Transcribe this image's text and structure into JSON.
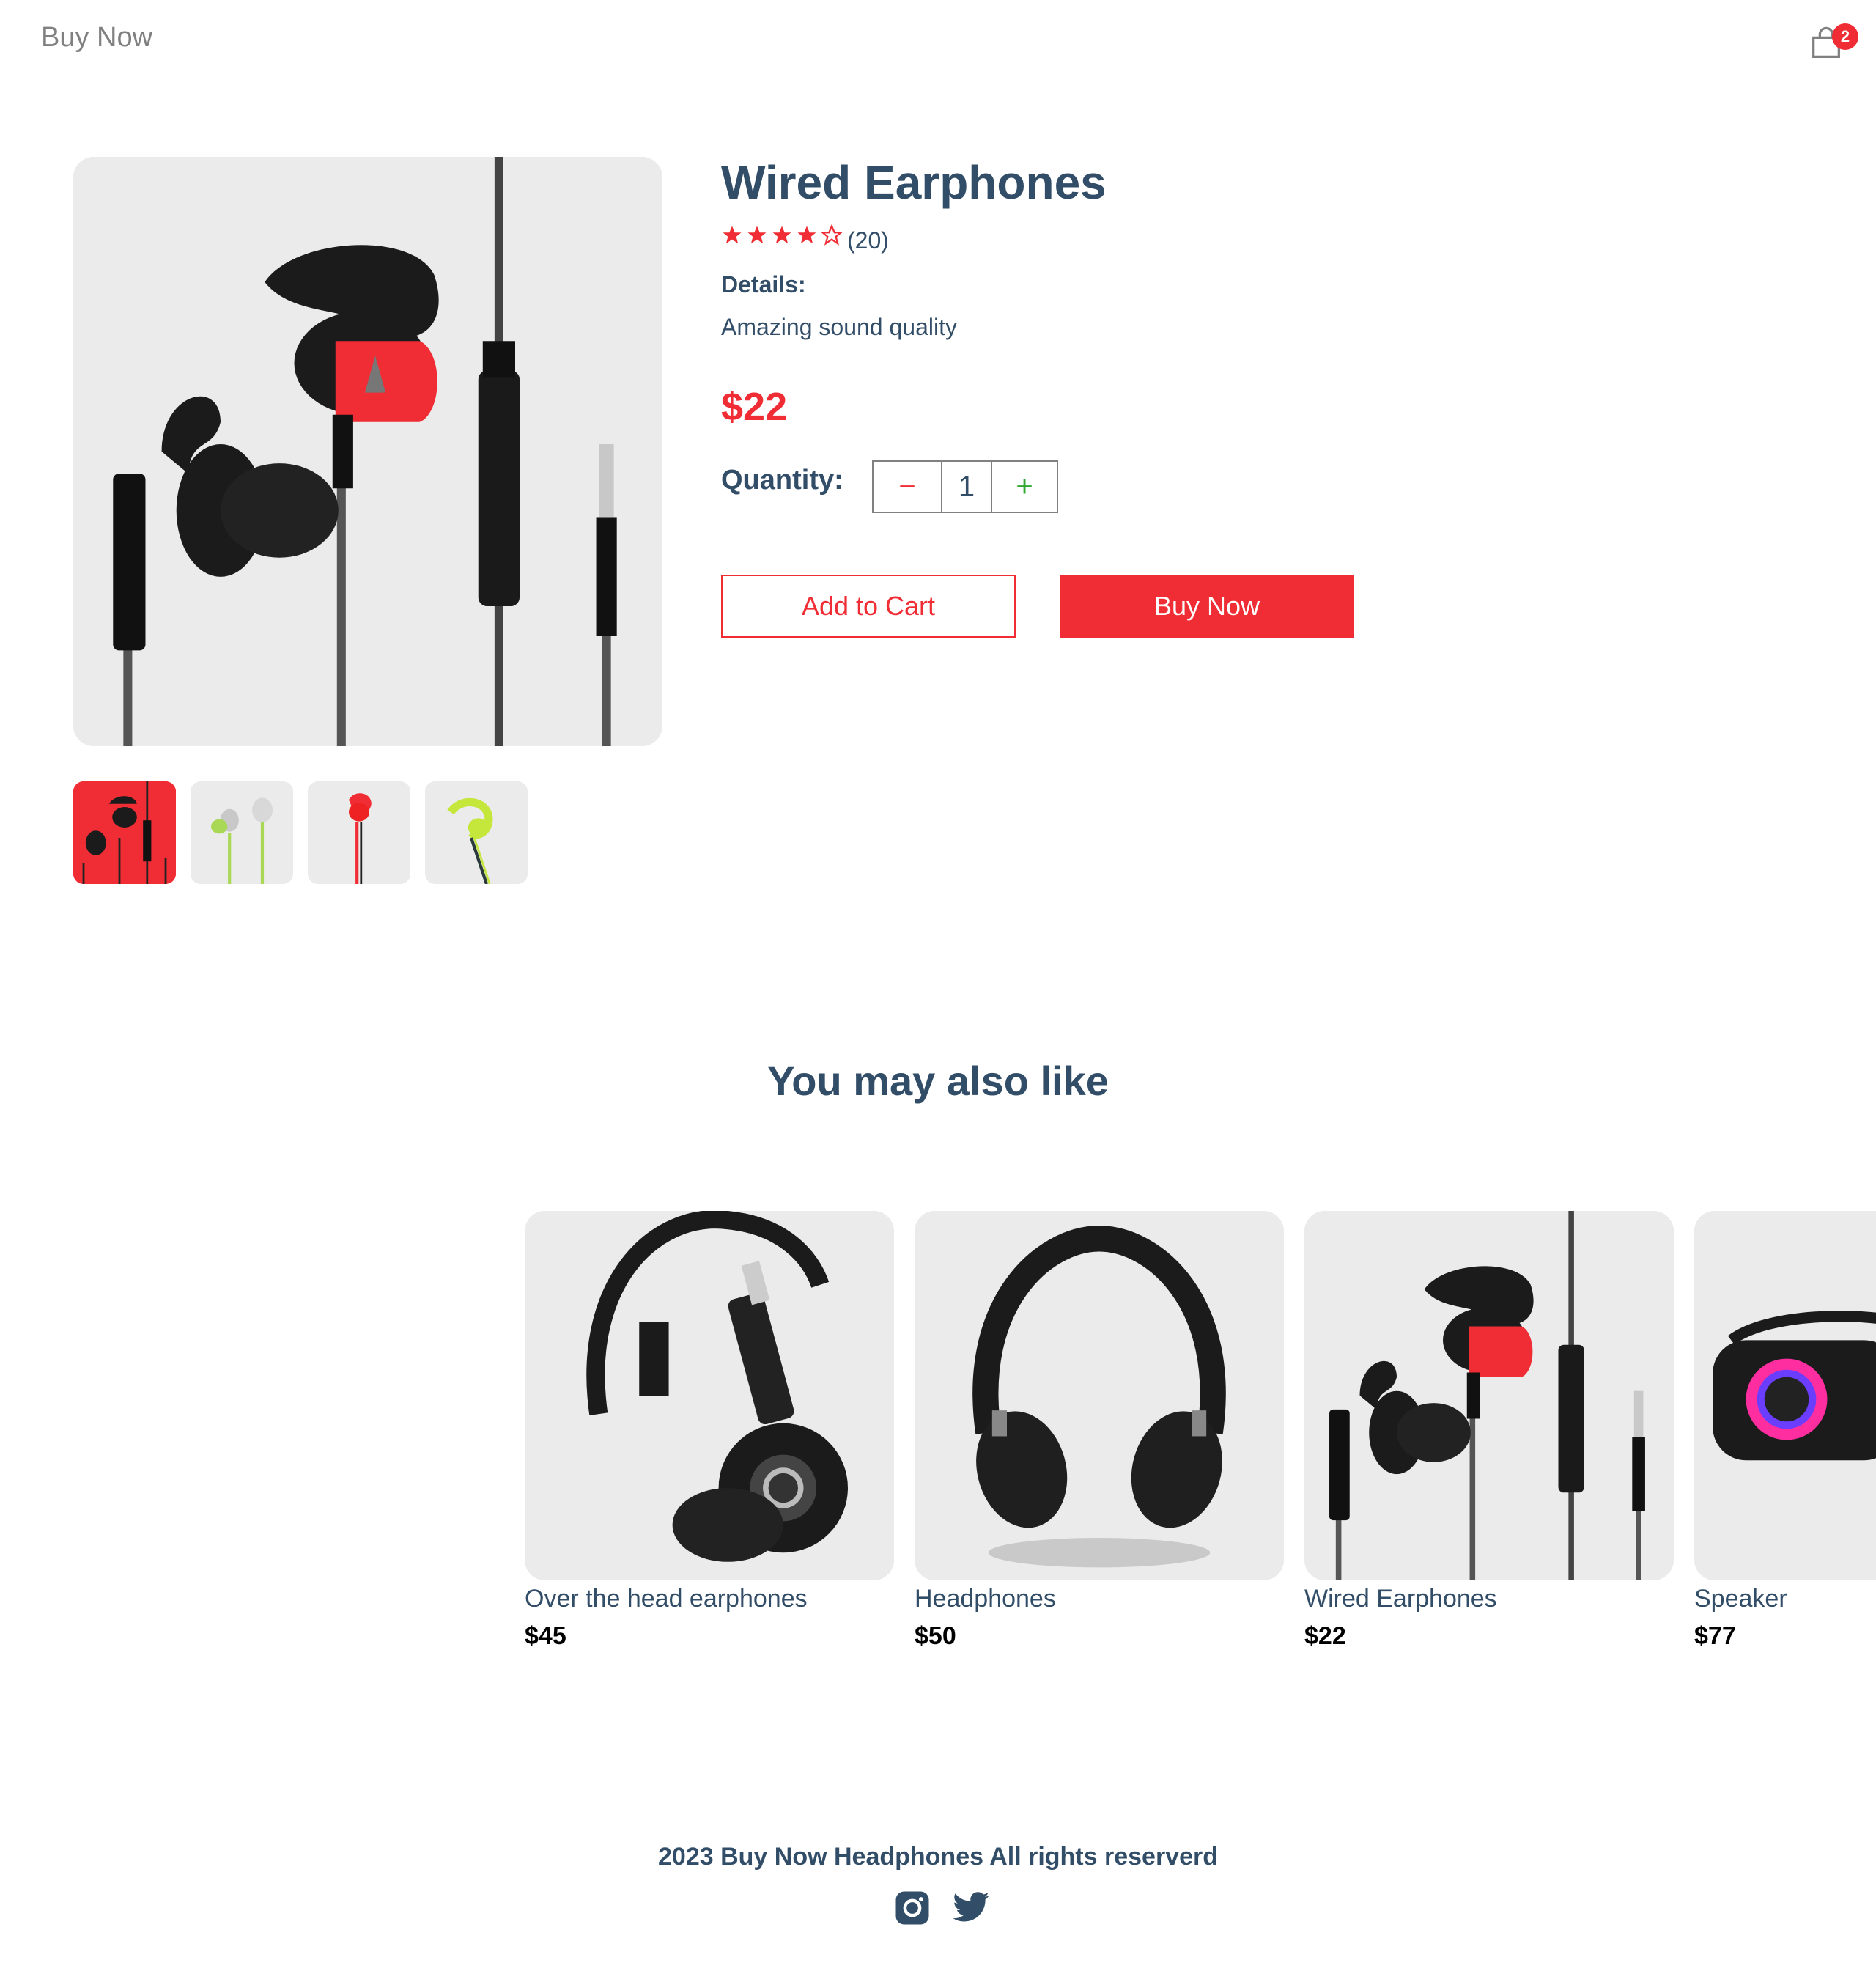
{
  "navbar": {
    "logo": "Buy Now",
    "cart_count": "2",
    "cart_icon": "shopping-bag-icon"
  },
  "product": {
    "name": "Wired Earphones",
    "rating_stars": 4,
    "rating_max": 5,
    "review_count": "(20)",
    "details_heading": "Details:",
    "details_text": "Amazing sound quality",
    "price": "$22",
    "quantity_label": "Quantity:",
    "quantity": "1",
    "minus": "−",
    "plus": "+",
    "add_to_cart": "Add to Cart",
    "buy_now": "Buy Now"
  },
  "colors": {
    "accent": "#f02d34",
    "text": "#324d67",
    "image_bg": "#ebebeb",
    "plus": "#31a831"
  },
  "recommendations": {
    "heading": "You may also like",
    "items": [
      {
        "name": "Over the head earphones",
        "price": "$45"
      },
      {
        "name": "Headphones",
        "price": "$50"
      },
      {
        "name": "Wired Earphones",
        "price": "$22"
      },
      {
        "name": "Speaker",
        "price": "$77"
      }
    ]
  },
  "footer": {
    "text": "2023 Buy Now Headphones All rights reserverd",
    "icons": [
      "instagram-icon",
      "twitter-icon"
    ]
  }
}
